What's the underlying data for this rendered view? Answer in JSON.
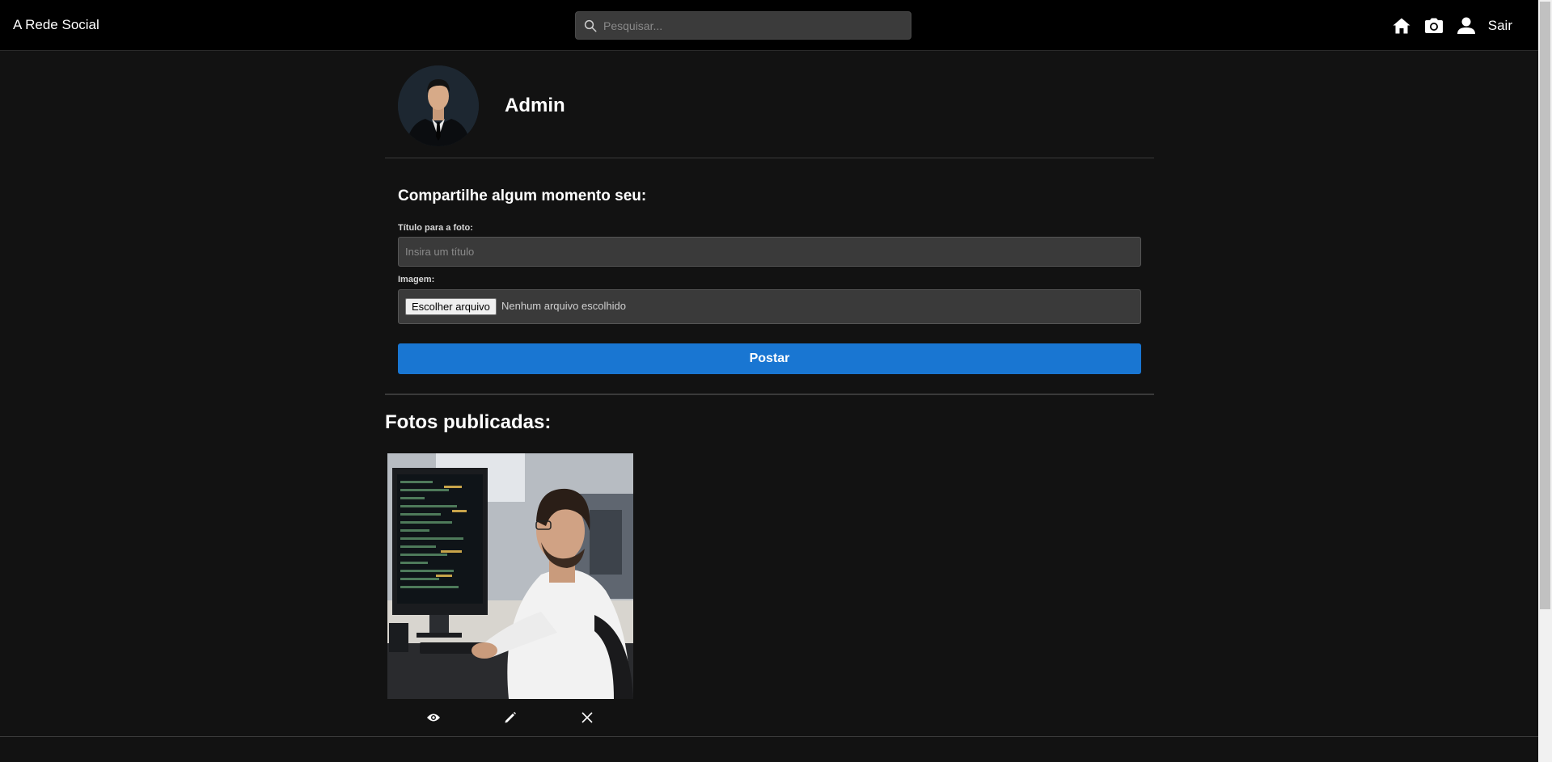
{
  "navbar": {
    "brand": "A Rede Social",
    "search_placeholder": "Pesquisar...",
    "icons": [
      "home-icon",
      "camera-icon",
      "user-icon"
    ],
    "logout_label": "Sair"
  },
  "profile": {
    "name": "Admin"
  },
  "share": {
    "title": "Compartilhe algum momento seu:",
    "title_label": "Título para a foto:",
    "title_placeholder": "Insira um título",
    "image_label": "Imagem:",
    "file_button": "Escolher arquivo",
    "file_status": "Nenhum arquivo escolhido",
    "post_button": "Postar"
  },
  "photos": {
    "title": "Fotos publicadas:",
    "items": [
      {
        "actions": [
          "eye-icon",
          "pencil-icon",
          "close-icon"
        ]
      }
    ]
  },
  "colors": {
    "background": "#121212",
    "navbar": "#000000",
    "input_bg": "#3a3a3a",
    "accent": "#1976d2"
  }
}
